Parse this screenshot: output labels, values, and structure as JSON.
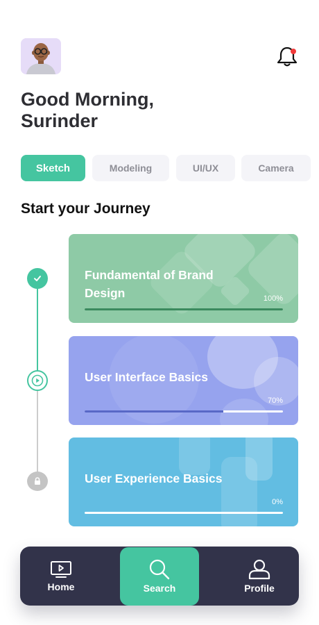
{
  "header": {
    "greeting_line1": "Good Morning,",
    "greeting_line2": "Surinder",
    "avatar_icon": "user-avatar",
    "notification_icon": "bell-icon",
    "notification_dot_color": "#f13a3a"
  },
  "categories": [
    {
      "label": "Sketch",
      "active": true
    },
    {
      "label": "Modeling",
      "active": false
    },
    {
      "label": "UI/UX",
      "active": false
    },
    {
      "label": "Camera",
      "active": false
    }
  ],
  "section_title": "Start your Journey",
  "courses": [
    {
      "title": "Fundamental of Brand Design",
      "progress_label": "100%",
      "progress": 1.0,
      "status": "completed",
      "status_icon": "check-icon",
      "color": "#8ecaa6"
    },
    {
      "title": "User Interface Basics",
      "progress_label": "70%",
      "progress": 0.7,
      "status": "in-progress",
      "status_icon": "play-icon",
      "color": "#96a3ee"
    },
    {
      "title": "User Experience Basics",
      "progress_label": "0%",
      "progress": 0.0,
      "status": "locked",
      "status_icon": "lock-icon",
      "color": "#62bde2"
    }
  ],
  "nav": [
    {
      "label": "Home",
      "icon": "tv-icon",
      "active": false
    },
    {
      "label": "Search",
      "icon": "search-icon",
      "active": true
    },
    {
      "label": "Profile",
      "icon": "user-icon",
      "active": false
    }
  ],
  "colors": {
    "accent": "#45c5a0",
    "nav_bg": "#32334a",
    "inactive_chip_bg": "#f4f4f8"
  }
}
